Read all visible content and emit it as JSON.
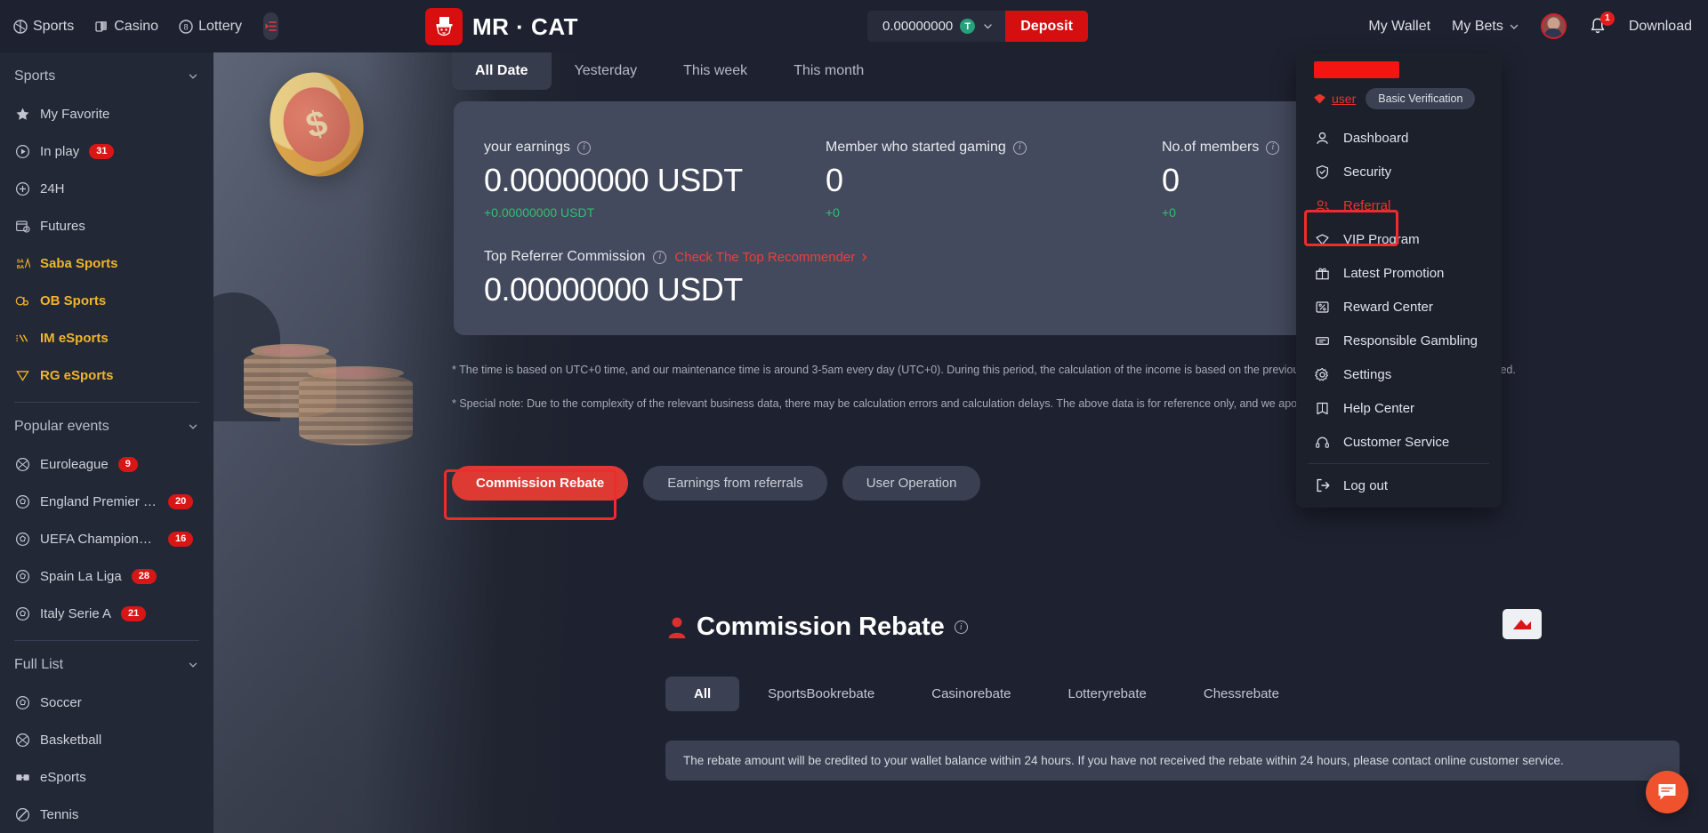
{
  "topbar": {
    "nav": [
      {
        "label": "Sports",
        "icon": "sports-ball-icon"
      },
      {
        "label": "Casino",
        "icon": "cards-icon"
      },
      {
        "label": "Lottery",
        "icon": "lottery-ball-icon"
      }
    ],
    "collapse_icon": "collapse-sidebar-icon",
    "logo_text": "MR · CAT",
    "logo_icon": "cat-top-hat-icon",
    "balance": "0.00000000",
    "currency_symbol": "T",
    "currency_name": "USDT",
    "chevron_icon": "chevron-down-icon",
    "deposit_label": "Deposit",
    "my_wallet_label": "My Wallet",
    "my_bets_label": "My Bets",
    "notification_count": "1",
    "download_label": "Download"
  },
  "sidebar": {
    "sections": [
      {
        "title": "Sports",
        "items": [
          {
            "label": "My Favorite",
            "icon": "star-icon",
            "badge": "",
            "highlight": false
          },
          {
            "label": "In play",
            "icon": "play-circle-icon",
            "badge": "31",
            "highlight": false
          },
          {
            "label": "24H",
            "icon": "clock-plus-icon",
            "badge": "",
            "highlight": false
          },
          {
            "label": "Futures",
            "icon": "calendar-clock-icon",
            "badge": "",
            "highlight": false
          },
          {
            "label": "Saba Sports",
            "icon": "saba-icon",
            "badge": "",
            "highlight": true
          },
          {
            "label": "OB Sports",
            "icon": "ob-icon",
            "badge": "",
            "highlight": true
          },
          {
            "label": "IM eSports",
            "icon": "im-esports-icon",
            "badge": "",
            "highlight": true
          },
          {
            "label": "RG eSports",
            "icon": "rg-esports-icon",
            "badge": "",
            "highlight": true
          }
        ]
      },
      {
        "title": "Popular events",
        "items": [
          {
            "label": "Euroleague",
            "icon": "basketball-icon",
            "badge": "9",
            "highlight": false
          },
          {
            "label": "England Premier Lea...",
            "icon": "soccer-icon",
            "badge": "20",
            "highlight": false
          },
          {
            "label": "UEFA Champions Lea...",
            "icon": "soccer-icon",
            "badge": "16",
            "highlight": false
          },
          {
            "label": "Spain La Liga",
            "icon": "soccer-icon",
            "badge": "28",
            "highlight": false
          },
          {
            "label": "Italy Serie A",
            "icon": "soccer-icon",
            "badge": "21",
            "highlight": false
          }
        ]
      },
      {
        "title": "Full List",
        "items": [
          {
            "label": "Soccer",
            "icon": "soccer-icon",
            "badge": "",
            "highlight": false
          },
          {
            "label": "Basketball",
            "icon": "basketball-icon",
            "badge": "",
            "highlight": false
          },
          {
            "label": "eSports",
            "icon": "esports-icon",
            "badge": "",
            "highlight": false
          },
          {
            "label": "Tennis",
            "icon": "tennis-icon",
            "badge": "",
            "highlight": false
          }
        ]
      }
    ]
  },
  "main": {
    "date_tabs": [
      {
        "label": "All Date",
        "active": true
      },
      {
        "label": "Yesterday",
        "active": false
      },
      {
        "label": "This week",
        "active": false
      },
      {
        "label": "This month",
        "active": false
      }
    ],
    "stats": {
      "earnings_label": "your earnings",
      "earnings_value": "0.00000000 USDT",
      "earnings_delta": "+0.00000000 USDT",
      "members_gaming_label": "Member who started gaming",
      "members_gaming_value": "0",
      "members_gaming_delta": "+0",
      "members_label": "No.of members",
      "members_value": "0",
      "members_delta": "+0",
      "top_commission_label": "Top Referrer Commission",
      "top_commission_link": "Check The Top Recommender",
      "top_commission_value": "0.00000000 USDT"
    },
    "notes": [
      "* The time is based on UTC+0 time, and our maintenance time is around 3-5am every day (UTC+0). During this period, the calculation of the income is based on the previous day's data, daily income can be displayed.",
      "* Special note: Due to the complexity of the relevant business data, there may be calculation errors and calculation delays. The above data is for reference only, and we apologize for"
    ],
    "mode_tabs": [
      {
        "label": "Commission Rebate",
        "active": true
      },
      {
        "label": "Earnings from referrals",
        "active": false
      },
      {
        "label": "User Operation",
        "active": false
      }
    ],
    "section_title": "Commission Rebate",
    "rebate_tabs": [
      {
        "label": "All",
        "active": true
      },
      {
        "label": "SportsBookrebate",
        "active": false
      },
      {
        "label": "Casinorebate",
        "active": false
      },
      {
        "label": "Lotteryrebate",
        "active": false
      },
      {
        "label": "Chessrebate",
        "active": false
      }
    ],
    "notice": "The rebate amount will be credited to your wallet balance within 24 hours. If you have not received the rebate within 24 hours, please contact online customer service."
  },
  "dropdown": {
    "username": "user",
    "verification_label": "Basic Verification",
    "items": [
      {
        "label": "Dashboard",
        "icon": "user-icon",
        "selected": false
      },
      {
        "label": "Security",
        "icon": "shield-check-icon",
        "selected": false
      },
      {
        "label": "Referral",
        "icon": "users-icon",
        "selected": true
      },
      {
        "label": "VIP Program",
        "icon": "diamond-icon",
        "selected": false
      },
      {
        "label": "Latest Promotion",
        "icon": "gift-icon",
        "selected": false
      },
      {
        "label": "Reward Center",
        "icon": "percent-icon",
        "selected": false
      },
      {
        "label": "Responsible Gambling",
        "icon": "ticket-icon",
        "selected": false
      },
      {
        "label": "Settings",
        "icon": "gear-icon",
        "selected": false
      },
      {
        "label": "Help Center",
        "icon": "book-icon",
        "selected": false
      },
      {
        "label": "Customer Service",
        "icon": "headset-icon",
        "selected": false
      }
    ],
    "logout_label": "Log out",
    "logout_icon": "logout-icon"
  },
  "chat": {
    "icon": "chat-bubble-icon"
  },
  "colors": {
    "accent_red": "#d50f0f",
    "highlight_red": "#ef2b2b",
    "gold": "#f0b429",
    "green": "#2fbf71",
    "card_bg": "#444a5d",
    "panel_bg": "#1e2230"
  }
}
